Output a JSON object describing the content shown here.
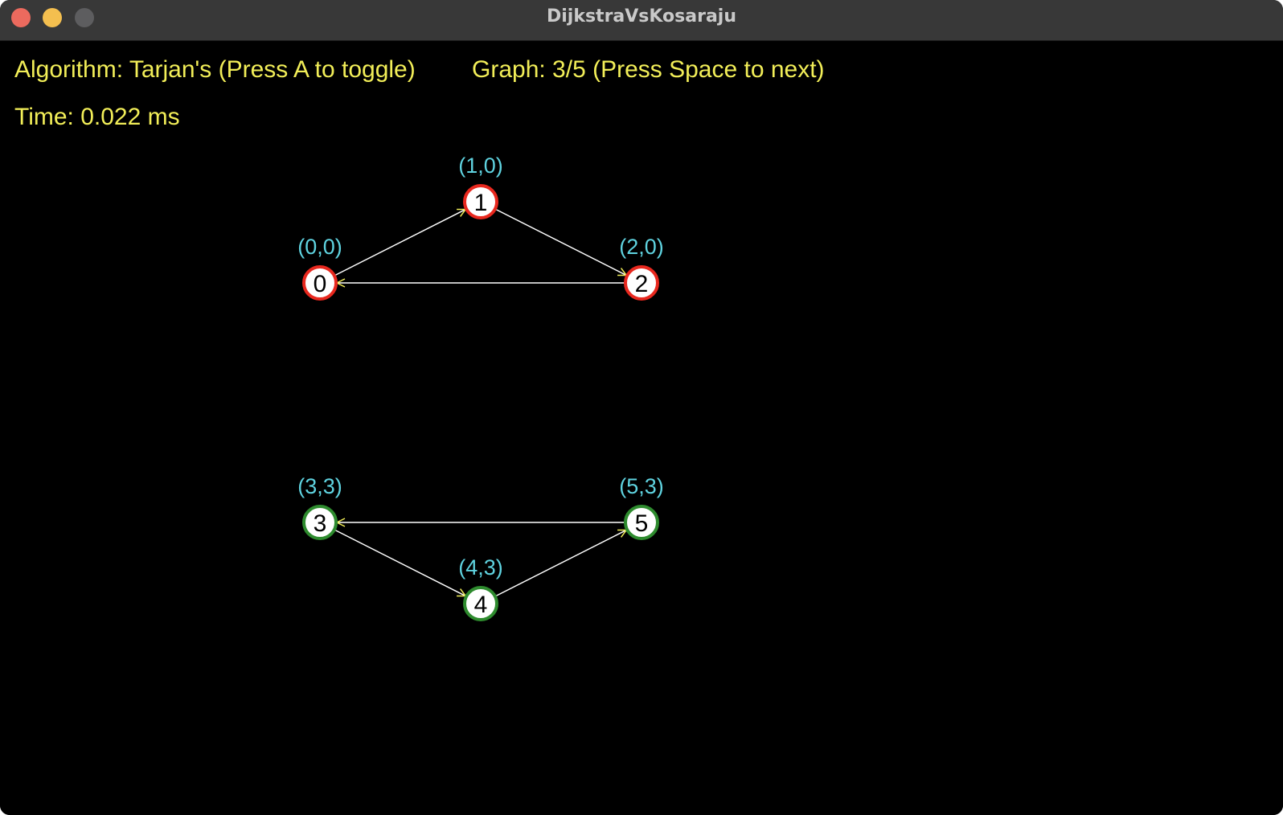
{
  "window": {
    "title": "DijkstraVsKosaraju"
  },
  "hud": {
    "algorithm": "Algorithm: Tarjan's (Press A to toggle)",
    "graph": "Graph: 3/5 (Press Space to next)",
    "time": "Time: 0.022 ms"
  },
  "colors": {
    "background": "#000000",
    "hud_text": "#f2ee58",
    "coord_text": "#5fd3e0",
    "edge": "#ffffff",
    "arrowhead": "#f2ee58",
    "node_fill": "#ffffff",
    "scc_red": "#e8281e",
    "scc_green": "#2e8b2e"
  },
  "graph": {
    "nodes": [
      {
        "id": "0",
        "label": "0",
        "coord": "(0,0)",
        "scc": "scc_red"
      },
      {
        "id": "1",
        "label": "1",
        "coord": "(1,0)",
        "scc": "scc_red"
      },
      {
        "id": "2",
        "label": "2",
        "coord": "(2,0)",
        "scc": "scc_red"
      },
      {
        "id": "3",
        "label": "3",
        "coord": "(3,3)",
        "scc": "scc_green"
      },
      {
        "id": "4",
        "label": "4",
        "coord": "(4,3)",
        "scc": "scc_green"
      },
      {
        "id": "5",
        "label": "5",
        "coord": "(5,3)",
        "scc": "scc_green"
      }
    ],
    "edges": [
      {
        "from": "0",
        "to": "1"
      },
      {
        "from": "1",
        "to": "2"
      },
      {
        "from": "2",
        "to": "0"
      },
      {
        "from": "3",
        "to": "4"
      },
      {
        "from": "4",
        "to": "5"
      },
      {
        "from": "5",
        "to": "3"
      }
    ]
  }
}
